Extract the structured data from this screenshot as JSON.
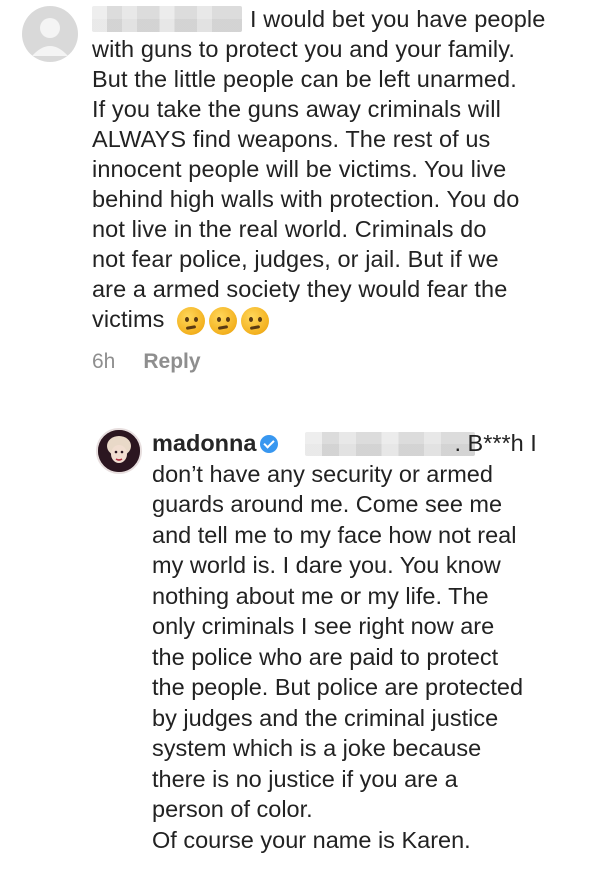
{
  "comment": {
    "lines": [
      "I would bet you have people",
      "with guns to protect you and your family.",
      "But the little people can be left unarmed.",
      "If you take the guns away criminals will",
      "ALWAYS find weapons. The rest of us",
      "innocent people will be victims. You live",
      "behind high walls with protection. You do",
      "not live in the real world.  Criminals do",
      "not fear police, judges, or jail. But if we",
      "are a armed society they would fear the",
      "victims"
    ],
    "emoji_names": [
      "thinking-face-icon",
      "thinking-face-icon",
      "thinking-face-icon"
    ],
    "time": "6h",
    "reply_label": "Reply"
  },
  "reply": {
    "username": "madonna",
    "lines": [
      ". B***h I",
      "don’t have any security or armed",
      "guards around me. Come see me",
      "and tell me to my face how not real",
      "my world is. I dare you.  You know",
      "nothing about me or my life. The",
      "only criminals I see right now are",
      "the police who are paid to protect",
      "the people. But police are protected",
      "by judges and the criminal justice",
      "system which is a joke because",
      "there is no justice if you are a",
      "person of color.",
      "Of course your name is Karen."
    ]
  },
  "colors": {
    "verified_badge": "#3897f0",
    "meta_text": "#8e8e8e",
    "body_text": "#222222"
  }
}
